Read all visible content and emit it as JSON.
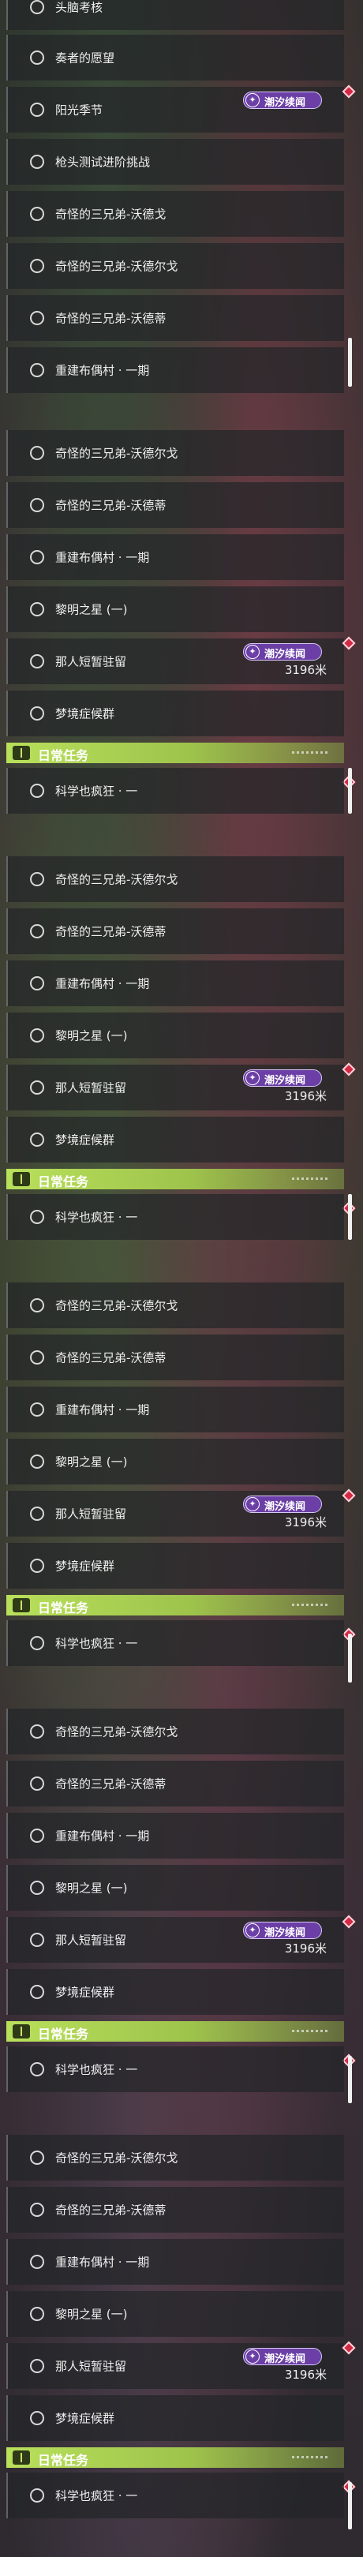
{
  "panels": [
    {
      "items": [
        {
          "label": "头脑考核"
        },
        {
          "label": "奏者的愿望"
        },
        {
          "label": "阳光季节",
          "badge": "潮汐续闻"
        },
        {
          "label": "枪头测试进阶挑战"
        },
        {
          "label": "奇怪的三兄弟-沃德戈"
        },
        {
          "label": "奇怪的三兄弟-沃德尔戈"
        },
        {
          "label": "奇怪的三兄弟-沃德蒂"
        },
        {
          "label": "重建布偶村 · 一期"
        }
      ]
    },
    {
      "items": [
        {
          "label": "奇怪的三兄弟-沃德尔戈"
        },
        {
          "label": "奇怪的三兄弟-沃德蒂"
        },
        {
          "label": "重建布偶村 · 一期"
        },
        {
          "label": "黎明之星 (一)"
        },
        {
          "label": "那人短暂驻留",
          "badge": "潮汐续闻",
          "distance": "3196米"
        },
        {
          "label": "梦境症候群"
        }
      ],
      "daily": {
        "title": "日常任务",
        "item": "科学也疯狂 · 一"
      }
    },
    {
      "items": [
        {
          "label": "奇怪的三兄弟-沃德尔戈"
        },
        {
          "label": "奇怪的三兄弟-沃德蒂"
        },
        {
          "label": "重建布偶村 · 一期"
        },
        {
          "label": "黎明之星 (一)"
        },
        {
          "label": "那人短暂驻留",
          "badge": "潮汐续闻",
          "distance": "3196米"
        },
        {
          "label": "梦境症候群"
        }
      ],
      "daily": {
        "title": "日常任务",
        "item": "科学也疯狂 · 一"
      }
    },
    {
      "items": [
        {
          "label": "奇怪的三兄弟-沃德尔戈"
        },
        {
          "label": "奇怪的三兄弟-沃德蒂"
        },
        {
          "label": "重建布偶村 · 一期"
        },
        {
          "label": "黎明之星 (一)"
        },
        {
          "label": "那人短暂驻留",
          "badge": "潮汐续闻",
          "distance": "3196米"
        },
        {
          "label": "梦境症候群"
        }
      ],
      "daily": {
        "title": "日常任务",
        "item": "科学也疯狂 · 一"
      }
    },
    {
      "items": [
        {
          "label": "奇怪的三兄弟-沃德尔戈"
        },
        {
          "label": "奇怪的三兄弟-沃德蒂"
        },
        {
          "label": "重建布偶村 · 一期"
        },
        {
          "label": "黎明之星 (一)"
        },
        {
          "label": "那人短暂驻留",
          "badge": "潮汐续闻",
          "distance": "3196米"
        },
        {
          "label": "梦境症候群"
        }
      ],
      "daily": {
        "title": "日常任务",
        "item": "科学也疯狂 · 一"
      }
    },
    {
      "items": [
        {
          "label": "奇怪的三兄弟-沃德尔戈"
        },
        {
          "label": "奇怪的三兄弟-沃德蒂"
        },
        {
          "label": "重建布偶村 · 一期"
        },
        {
          "label": "黎明之星 (一)"
        },
        {
          "label": "那人短暂驻留",
          "badge": "潮汐续闻",
          "distance": "3196米"
        },
        {
          "label": "梦境症候群"
        }
      ],
      "daily": {
        "title": "日常任务",
        "item": "科学也疯狂 · 一"
      }
    }
  ],
  "icons": {
    "row_marker": "circle-icon",
    "badge": "tide-swirl-icon",
    "gem": "red-diamond-icon",
    "header": "book-icon"
  },
  "colors": {
    "badge_bg": "#6b3fa6",
    "header_green": "#b9e05b",
    "gem_red": "#d22a45"
  }
}
